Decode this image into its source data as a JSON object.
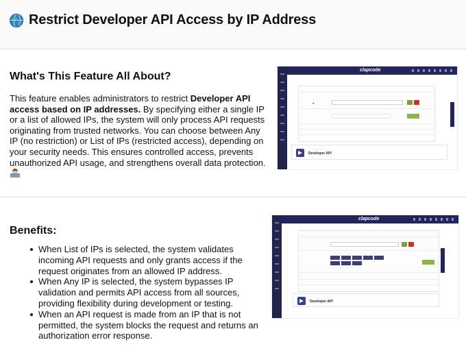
{
  "header": {
    "icon": "globe-icon",
    "title": "Restrict Developer API Access by IP Address"
  },
  "section1": {
    "title": "What's This Feature All About?",
    "body_lead": "This feature enables administrators to restrict ",
    "body_bold": "Developer API access based on IP addresses.",
    "body_rest": " By specifying either a single IP or a list of allowed IPs, the system will only process API requests originating from trusted networks. You can choose between Any IP (no restriction) or List of IPs (restricted access), depending on your security needs. This ensures controlled access, prevents unauthorized API usage, and strengthens overall data protection.",
    "trailing_emoji": "technologist-emoji"
  },
  "section2": {
    "title": "Benefits:",
    "items": [
      "When List of IPs is selected, the system validates incoming API requests and only grants access if the request originates from an allowed IP address.",
      "When Any IP is selected, the system bypasses IP validation and permits API access from all sources, providing flexibility during development or testing.",
      "When an API request is made from an IP that is not permitted, the system blocks the request and returns an authorization error response."
    ]
  },
  "screenshots": {
    "brand": "clapcode",
    "footer_label": "Developer API"
  },
  "colors": {
    "nav": "#22244b",
    "accent_green": "#7aa33a",
    "accent_red": "#c9302c"
  }
}
